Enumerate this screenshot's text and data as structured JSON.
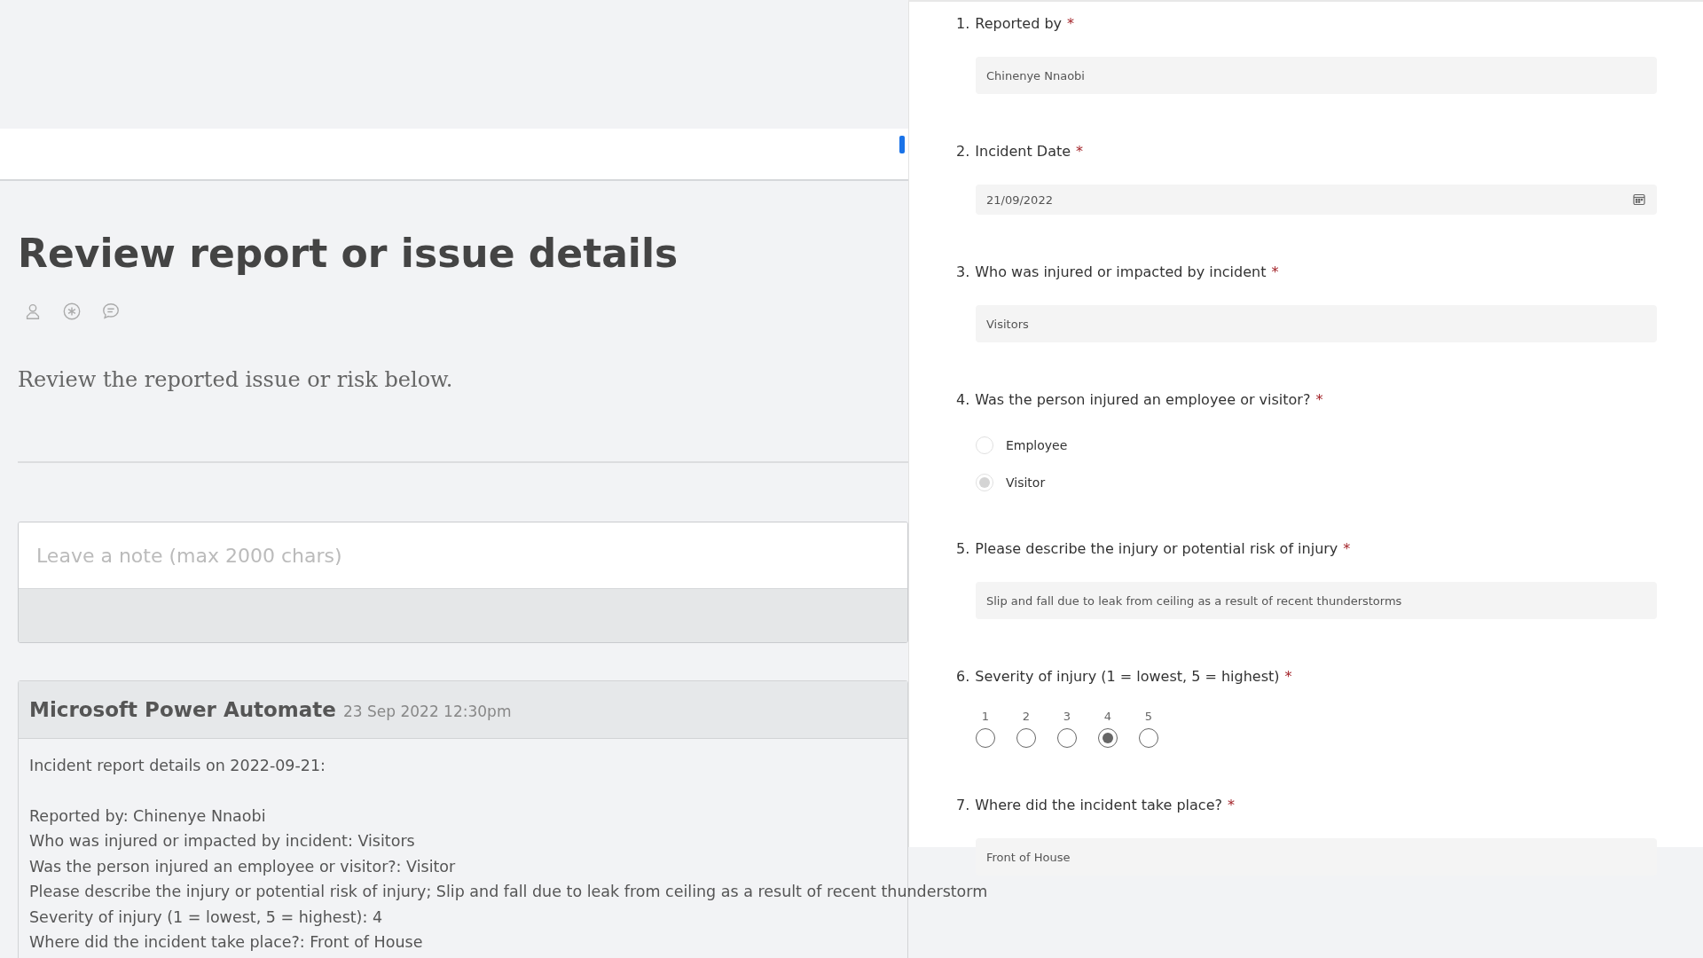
{
  "page": {
    "title": "Review report or issue details",
    "subtitle": "Review the reported issue or risk below.",
    "note": {
      "placeholder": "Leave a note (max 2000 chars)"
    }
  },
  "comment": {
    "author": "Microsoft Power Automate",
    "timestamp": "23 Sep 2022 12:30pm",
    "intro": "Incident report details on 2022-09-21:",
    "details": [
      "Reported by: Chinenye Nnaobi",
      "Who was injured or impacted by incident: Visitors",
      "Was the person injured an employee or visitor?: Visitor",
      "Please describe the injury or potential risk of injury; Slip and fall due to leak from ceiling as a result of recent thunderstorm",
      "Severity of injury (1 = lowest, 5 = highest): 4",
      "Where did the incident take place?: Front of House"
    ]
  },
  "form": {
    "required_mark": "*",
    "questions": [
      {
        "kind": "text",
        "number": "1.",
        "label": "Reported by",
        "value": "Chinenye Nnaobi"
      },
      {
        "kind": "date",
        "number": "2.",
        "label": "Incident Date",
        "value": "21/09/2022"
      },
      {
        "kind": "text",
        "number": "3.",
        "label": "Who was injured or impacted by incident",
        "value": "Visitors"
      },
      {
        "kind": "choice",
        "number": "4.",
        "label": "Was the person injured an employee or visitor?",
        "options": [
          {
            "label": "Employee",
            "selected": false
          },
          {
            "label": "Visitor",
            "selected": true
          }
        ]
      },
      {
        "kind": "text",
        "number": "5.",
        "label": "Please describe the injury or potential risk of injury",
        "value": "Slip and fall due to leak from ceiling as a result of recent thunderstorms"
      },
      {
        "kind": "rating",
        "number": "6.",
        "label": "Severity of injury (1 = lowest, 5 = highest)",
        "options": [
          {
            "label": "1",
            "selected": false
          },
          {
            "label": "2",
            "selected": false
          },
          {
            "label": "3",
            "selected": false
          },
          {
            "label": "4",
            "selected": true
          },
          {
            "label": "5",
            "selected": false
          }
        ]
      },
      {
        "kind": "text",
        "number": "7.",
        "label": "Where did the incident take place?",
        "value": "Front of House"
      }
    ]
  }
}
